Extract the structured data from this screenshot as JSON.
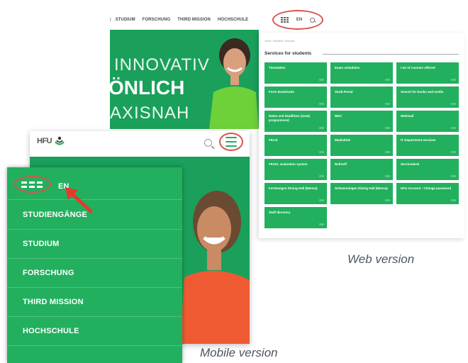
{
  "web": {
    "nav": {
      "separator": "|",
      "items": [
        "STUDIUM",
        "FORSCHUNG",
        "THIRD MISSION",
        "HOCHSCHULE"
      ],
      "lang": "EN"
    },
    "hero": {
      "line1": "INNOVATIV",
      "line2": "ÖNLICH",
      "line3": "AXISNAH"
    },
    "services": {
      "breadcrumb": "Home / Students / Services",
      "title": "Services for students",
      "tiles": [
        "Timetables",
        "Exam schedules",
        "List of courses offered",
        "Form downloads",
        "Studi-Portal",
        "Search for books and media",
        "Dates and deadlines (study programmes)",
        "NEO",
        "Webmail",
        "FELIX",
        "Mediathek",
        "IT Department services",
        "FEVAL evaluation system",
        "Refreeff",
        "Servicedesk",
        "Furtwangen Dining Hall (Mensa)",
        "Schwenningen Dining Hall (Mensa)",
        "HFU Account - Change password",
        "Staff directory"
      ]
    },
    "caption": "Web version"
  },
  "mobile": {
    "logo": "HFU",
    "lang": "EN",
    "menu": [
      "STUDIENGÄNGE",
      "STUDIUM",
      "FORSCHUNG",
      "THIRD MISSION",
      "HOCHSCHULE"
    ],
    "caption": "Mobile version"
  },
  "colors": {
    "accent": "#22b05e",
    "hero": "#1aa05b",
    "highlight": "#d9534f"
  }
}
